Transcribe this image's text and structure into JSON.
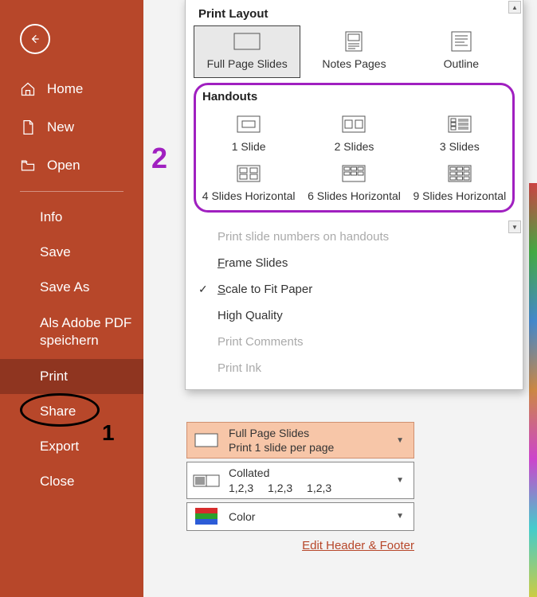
{
  "sidebar": {
    "top_nav": [
      {
        "label": "Home"
      },
      {
        "label": "New"
      },
      {
        "label": "Open"
      }
    ],
    "file_nav": [
      {
        "label": "Info"
      },
      {
        "label": "Save"
      },
      {
        "label": "Save As"
      },
      {
        "label": "Als Adobe PDF speichern"
      },
      {
        "label": "Print",
        "active": true
      },
      {
        "label": "Share"
      },
      {
        "label": "Export"
      },
      {
        "label": "Close"
      }
    ]
  },
  "flyout": {
    "print_layout_label": "Print Layout",
    "layouts": [
      {
        "label": "Full Page Slides"
      },
      {
        "label": "Notes Pages"
      },
      {
        "label": "Outline"
      }
    ],
    "handouts_label": "Handouts",
    "handouts": [
      {
        "label": "1 Slide"
      },
      {
        "label": "2 Slides"
      },
      {
        "label": "3 Slides"
      },
      {
        "label": "4 Slides Horizontal"
      },
      {
        "label": "6 Slides Horizontal"
      },
      {
        "label": "9 Slides Horizontal"
      }
    ],
    "options": {
      "print_slide_numbers": "Print slide numbers on handouts",
      "frame_slides": "Frame Slides",
      "scale_fit": "Scale to Fit Paper",
      "high_quality": "High Quality",
      "print_comments": "Print Comments",
      "print_ink": "Print Ink"
    }
  },
  "settings": {
    "layout_dd": {
      "title": "Full Page Slides",
      "sub": "Print 1 slide per page"
    },
    "collate_dd": {
      "title": "Collated",
      "sub": "1,2,3  1,2,3  1,2,3"
    },
    "color_dd": {
      "title": "Color"
    },
    "footer_link": "Edit Header & Footer"
  },
  "annotations": {
    "one": "1",
    "two": "2"
  }
}
